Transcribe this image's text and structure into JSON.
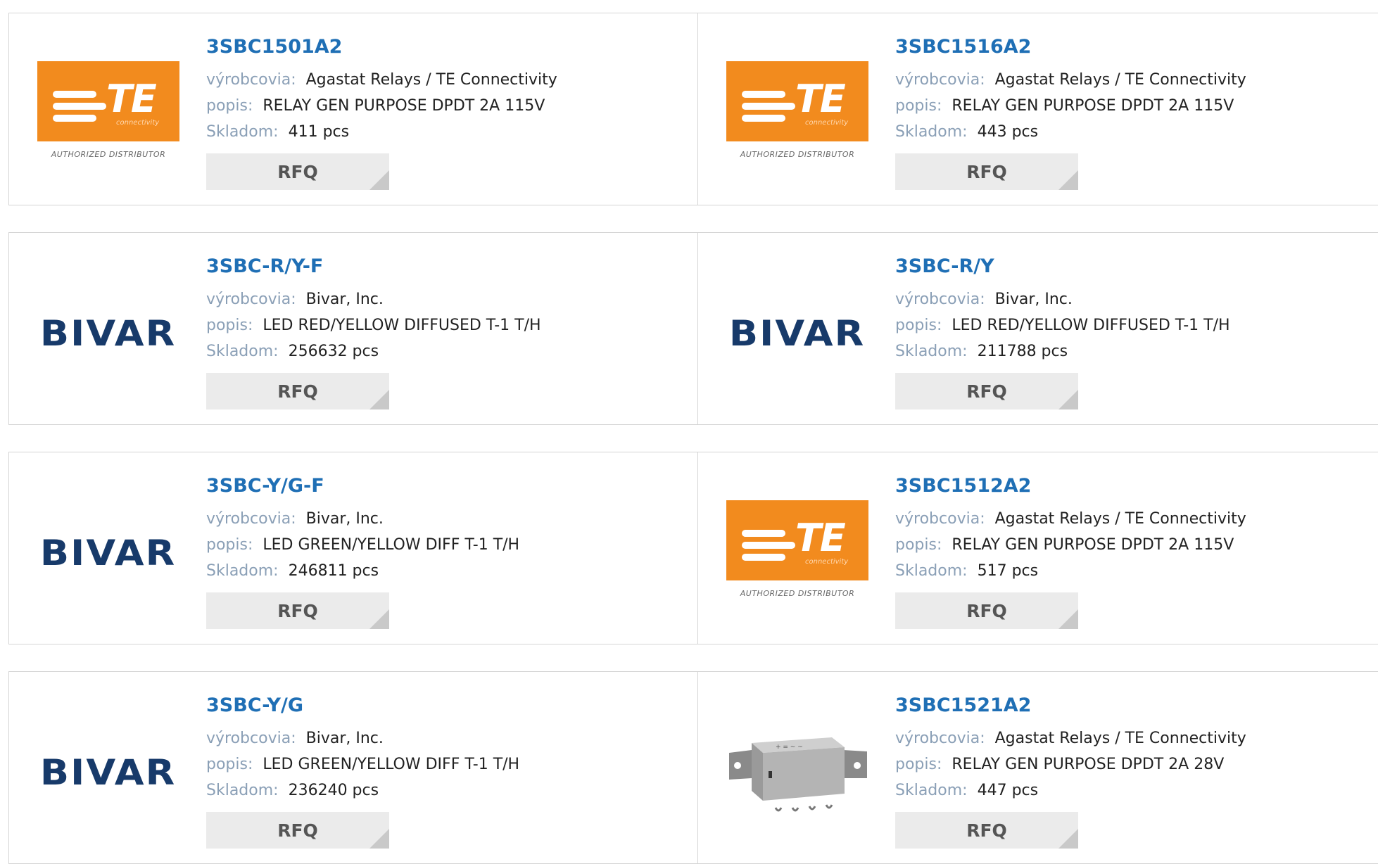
{
  "labels": {
    "manufacturer": "výrobcovia:",
    "description": "popis:",
    "stock": "Skladom:",
    "rfq": "RFQ"
  },
  "logos": {
    "te_text": "TE",
    "te_sub": "connectivity",
    "te_auth": "AUTHORIZED DISTRIBUTOR",
    "bivar_text": "BIVAR"
  },
  "products": [
    {
      "part": "3SBC1501A2",
      "manufacturer": "Agastat Relays / TE Connectivity",
      "description": "RELAY GEN PURPOSE DPDT 2A 115V",
      "stock": "411 pcs",
      "logo": "te-logo"
    },
    {
      "part": "3SBC1516A2",
      "manufacturer": "Agastat Relays / TE Connectivity",
      "description": "RELAY GEN PURPOSE DPDT 2A 115V",
      "stock": "443 pcs",
      "logo": "te-logo"
    },
    {
      "part": "3SBC-R/Y-F",
      "manufacturer": "Bivar, Inc.",
      "description": "LED RED/YELLOW DIFFUSED T-1 T/H",
      "stock": "256632 pcs",
      "logo": "bivar-logo"
    },
    {
      "part": "3SBC-R/Y",
      "manufacturer": "Bivar, Inc.",
      "description": "LED RED/YELLOW DIFFUSED T-1 T/H",
      "stock": "211788 pcs",
      "logo": "bivar-logo"
    },
    {
      "part": "3SBC-Y/G-F",
      "manufacturer": "Bivar, Inc.",
      "description": "LED GREEN/YELLOW DIFF T-1 T/H",
      "stock": "246811 pcs",
      "logo": "bivar-logo"
    },
    {
      "part": "3SBC1512A2",
      "manufacturer": "Agastat Relays / TE Connectivity",
      "description": "RELAY GEN PURPOSE DPDT 2A 115V",
      "stock": "517 pcs",
      "logo": "te-logo"
    },
    {
      "part": "3SBC-Y/G",
      "manufacturer": "Bivar, Inc.",
      "description": "LED GREEN/YELLOW DIFF T-1 T/H",
      "stock": "236240 pcs",
      "logo": "bivar-logo"
    },
    {
      "part": "3SBC1521A2",
      "manufacturer": "Agastat Relays / TE Connectivity",
      "description": "RELAY GEN PURPOSE DPDT 2A 28V",
      "stock": "447 pcs",
      "logo": "relay-photo"
    }
  ]
}
